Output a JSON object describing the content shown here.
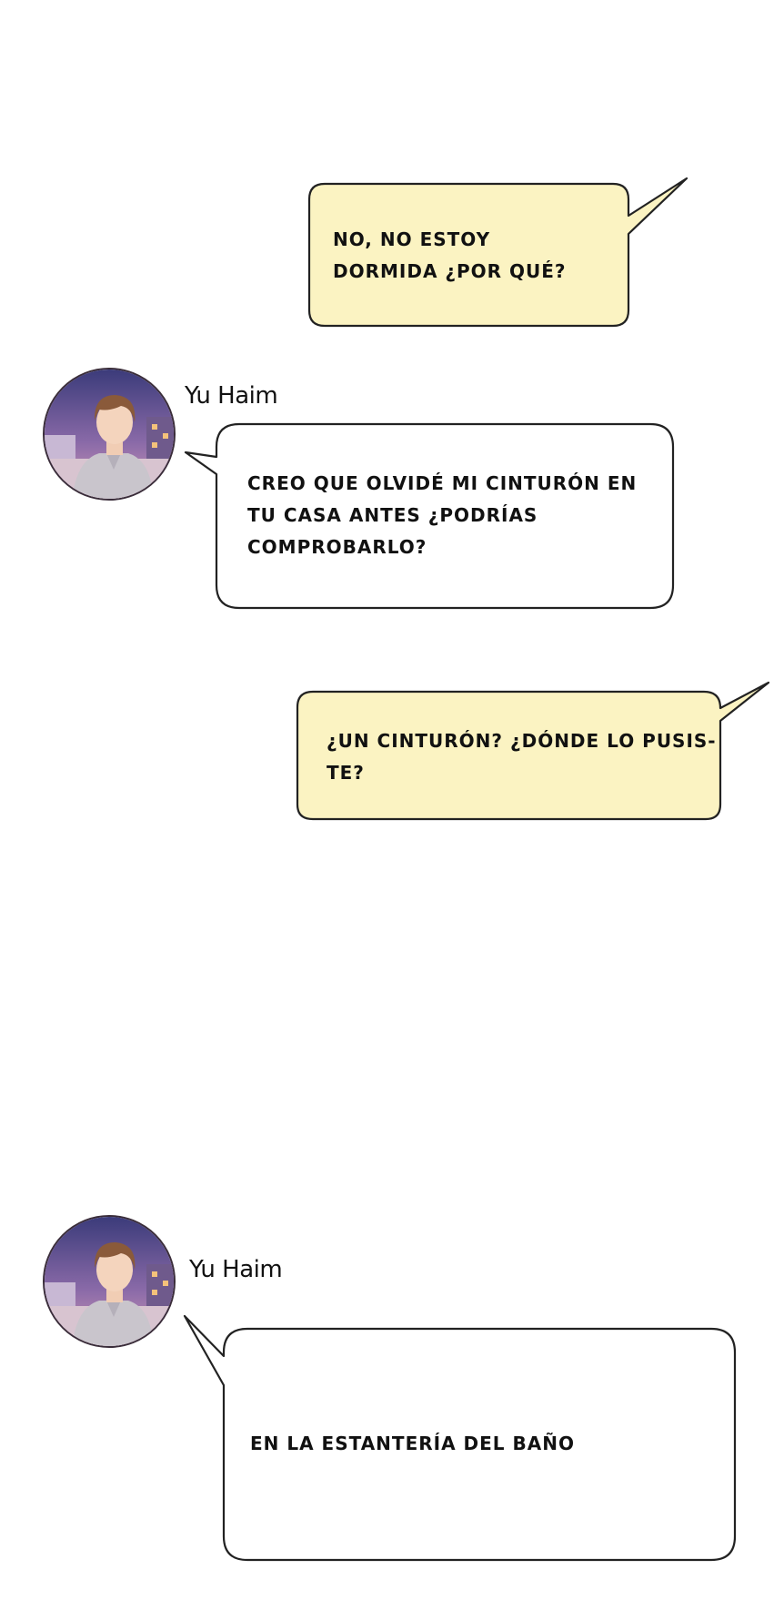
{
  "messages": [
    {
      "id": "m1",
      "side": "right",
      "text": "NO, NO ESTOY\nDORMIDA ¿POR QUÉ?",
      "bubble_color": "#fbf3c2"
    },
    {
      "id": "m2",
      "side": "left",
      "speaker": "Yu Haim",
      "text": "CREO QUE OLVIDÉ MI CINTURÓN EN\nTU CASA ANTES ¿PODRÍAS\nCOMPROBARLO?",
      "bubble_color": "#ffffff"
    },
    {
      "id": "m3",
      "side": "right",
      "text": "¿UN CINTURÓN? ¿DÓNDE LO PUSIS-\nTE?",
      "bubble_color": "#fbf3c2"
    },
    {
      "id": "m4",
      "side": "left",
      "speaker": "Yu Haim",
      "text": "EN LA ESTANTERÍA DEL BAÑO",
      "bubble_color": "#ffffff"
    }
  ],
  "colors": {
    "self_bubble": "#fbf3c2",
    "other_bubble": "#ffffff",
    "outline": "#222222"
  },
  "avatar_icon": "person-avatar-icon"
}
